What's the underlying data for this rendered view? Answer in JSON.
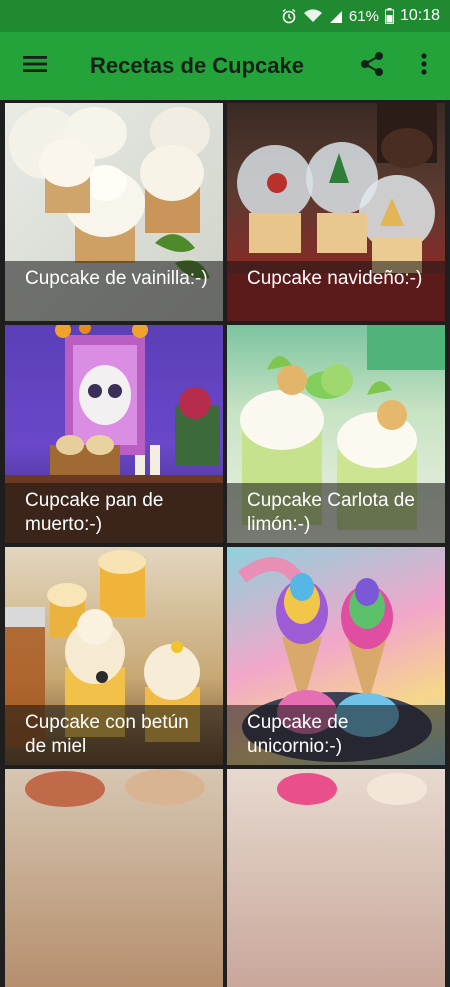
{
  "status": {
    "battery": "61%",
    "time": "10:18"
  },
  "app_bar": {
    "title": "Recetas de Cupcake"
  },
  "recipes": [
    {
      "label": "Cupcake de vainilla:-)"
    },
    {
      "label": "Cupcake navideño:-)"
    },
    {
      "label": "Cupcake pan de muerto:-)"
    },
    {
      "label": "Cupcake Carlota de limón:-)"
    },
    {
      "label": "Cupcake con betún de miel"
    },
    {
      "label": "Cupcake de unicornio:-)"
    },
    {
      "label": ""
    },
    {
      "label": ""
    }
  ],
  "colors": {
    "status_bar": "#1f8a2f",
    "app_bar": "#24a33a",
    "caption_overlay": "#141414"
  }
}
